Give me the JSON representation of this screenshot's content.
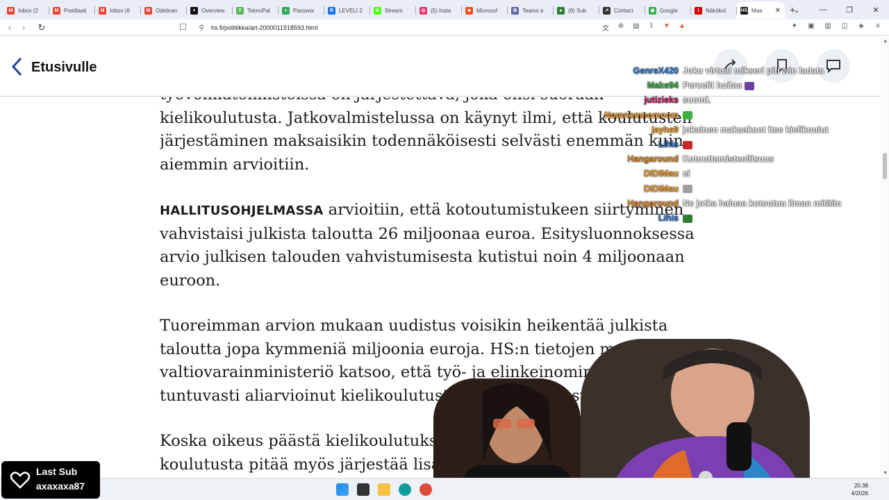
{
  "tabs": [
    {
      "title": "Inbox (2",
      "fav_color": "#ea4335",
      "fav_glyph": "M"
    },
    {
      "title": "Postilaati",
      "fav_color": "#ea4335",
      "fav_glyph": "M"
    },
    {
      "title": "Inbox (6",
      "fav_color": "#ea4335",
      "fav_glyph": "M"
    },
    {
      "title": "Odebran",
      "fav_color": "#ea4335",
      "fav_glyph": "M"
    },
    {
      "title": "Overview",
      "fav_color": "#111111",
      "fav_glyph": "+"
    },
    {
      "title": "TeknoPal",
      "fav_color": "#5cb85c",
      "fav_glyph": "T"
    },
    {
      "title": "Passwor",
      "fav_color": "#34a853",
      "fav_glyph": "+"
    },
    {
      "title": "LEVELI 2",
      "fav_color": "#1a73e8",
      "fav_glyph": "R"
    },
    {
      "title": "Stream",
      "fav_color": "#53fc18",
      "fav_glyph": "K"
    },
    {
      "title": "(5) Insta",
      "fav_color": "#e1306c",
      "fav_glyph": "◎"
    },
    {
      "title": "Microsof",
      "fav_color": "#f25022",
      "fav_glyph": "■"
    },
    {
      "title": "Teams a",
      "fav_color": "#6264a7",
      "fav_glyph": "⚙"
    },
    {
      "title": "(8) Sub",
      "fav_color": "#2e7d32",
      "fav_glyph": "●"
    },
    {
      "title": "Contact",
      "fav_color": "#333333",
      "fav_glyph": "↗"
    },
    {
      "title": "Google",
      "fav_color": "#34a853",
      "fav_glyph": "◉"
    },
    {
      "title": "Näkökul",
      "fav_color": "#d50000",
      "fav_glyph": "I"
    },
    {
      "title": "Maa",
      "fav_color": "#1a1a1a",
      "fav_glyph": "HS",
      "active": true
    }
  ],
  "toolbar": {
    "url": "hs.fi/politiikka/art-2000011918593.html"
  },
  "header": {
    "back_label": "Etusivulle"
  },
  "article": {
    "p0_partial": "työvoimatoimistoissa on järjestettävä, joka olisi suoraan kielikoulutusta. Jatkovalmistelussa on käynyt ilmi, että koulutusten järjestäminen maksaisikin todennäköisesti selvästi enemmän kuin aiemmin arvioitiin.",
    "p1_lead": "HALLITUSOHJELMASSA",
    "p1_rest": " arvioitiin, että kotoutumistukeen siirtyminen vahvistaisi julkista taloutta 26 miljoonaa euroa. Esitysluonnoksessa arvio julkisen talouden vahvistumisesta kutistui noin 4 miljoonaan euroon.",
    "p2": "Tuoreimman arvion mukaan uudistus voisikin heikentää julkista taloutta jopa kymmeniä miljoonia euroja. HS:n tietojen mukaan valtiovarainministeriö katsoo, että työ- ja elinkeinoministeriö on tuntuvasti aliarvioinut kielikoulutusten kysynnän kasvun.",
    "p3": "Koska oikeus päästä kielikoulutukseen vahvistuu, kyiseistä koulutusta pitää myös järjestää lisää. S"
  },
  "chat": [
    {
      "user": "GenreX420",
      "color": "#2f7bd1",
      "msg": "Joku virtual mikseri piti win ladata"
    },
    {
      "user": "Make94",
      "color": "#3cb043",
      "msg": "Percelit hoitaa",
      "emote": "#6b3fa0"
    },
    {
      "user": "jutizieks",
      "color": "#c2185b",
      "msg": "suomi."
    },
    {
      "user": "Nomnomnomnom",
      "color": "#f0a030",
      "msg": "",
      "emote": "#3cb043"
    },
    {
      "user": "jayhe9",
      "color": "#f0a030",
      "msg": "jokainen maksakoot itse kielikoulut"
    },
    {
      "user": "Lihis",
      "color": "#2f7bd1",
      "msg": "",
      "emote": "#c62828"
    },
    {
      "user": "Hangaround",
      "color": "#e08a2a",
      "msg": "Kotouttamisteollisuus"
    },
    {
      "user": "DIDIMau",
      "color": "#f0a030",
      "msg": "ei"
    },
    {
      "user": "DIDIMau",
      "color": "#f0a030",
      "msg": "",
      "emote": "#9e9e9e"
    },
    {
      "user": "Hangaround",
      "color": "#e08a2a",
      "msg": "Ne jotka haluaa kotoutuu ilman mitään"
    },
    {
      "user": "Lihis",
      "color": "#2f7bd1",
      "msg": "",
      "emote": "#2e7d32"
    }
  ],
  "lastsub": {
    "label": "Last Sub",
    "name": "axaxaxa87"
  },
  "taskbar": {
    "time": "20.38",
    "date": "4/2026"
  },
  "colors": {
    "accent_back": "#2a3a9c",
    "taskbar_bg": "#eef1f6"
  }
}
